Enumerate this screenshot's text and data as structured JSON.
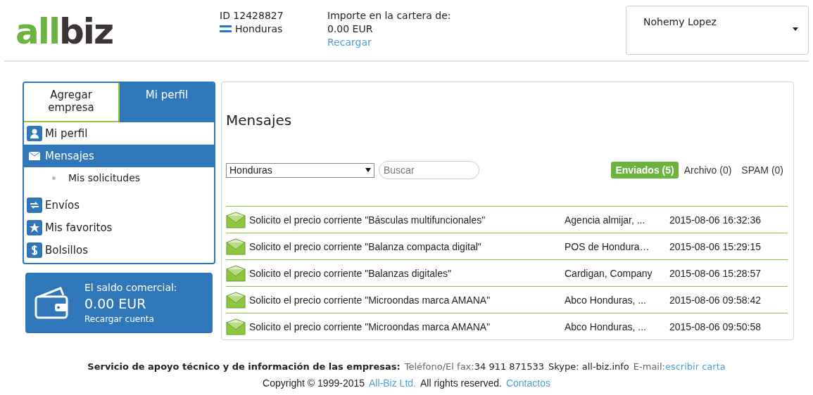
{
  "header": {
    "logo": [
      "all",
      "biz"
    ],
    "account_id": "ID 12428827",
    "country": "Honduras",
    "wallet_label": "Importe en la cartera de:",
    "wallet_amount": "0.00 EUR",
    "recharge_link": "Recargar",
    "user": "Nohemy Lopez"
  },
  "sidebar": {
    "tabs": [
      {
        "label": "Agregar empresa",
        "selected": false
      },
      {
        "label": "Mi perfil",
        "selected": true
      }
    ],
    "items": [
      {
        "label": "Mi perfil",
        "selected": false
      },
      {
        "label": "Mensajes",
        "selected": true,
        "children": [
          {
            "label": "Mis solicitudes"
          }
        ]
      },
      {
        "label": "Envíos",
        "selected": false
      },
      {
        "label": "Mis favoritos",
        "selected": false
      },
      {
        "label": "Bolsillos",
        "selected": false
      }
    ],
    "balance": {
      "label": "El saldo comercial:",
      "amount": "0.00 EUR",
      "link": "Recargar cuenta"
    }
  },
  "messages": {
    "title": "Mensajes",
    "country_select": "Honduras",
    "search": {
      "placeholder": "Buscar"
    },
    "folders": [
      {
        "label": "Enviados (5)",
        "selected": true
      },
      {
        "label": "Archivo (0)",
        "selected": false
      },
      {
        "label": "SPAM (0)",
        "selected": false
      }
    ],
    "rows": [
      {
        "subject": "Solicito el precio corriente \"Básculas multifuncionales\"",
        "company": "Agencia almijar, ...",
        "date": "2015-08-06 16:32:36"
      },
      {
        "subject": "Solicito el precio corriente \"Balanza compacta digital\"",
        "company": "POS de Hondura…",
        "date": "2015-08-06 15:29:15"
      },
      {
        "subject": "Solicito el precio corriente \"Balanzas digitales\"",
        "company": "Cardigan, Company",
        "date": "2015-08-06 15:28:57"
      },
      {
        "subject": "Solicito el precio corriente \"Microondas marca AMANA\"",
        "company": "Abco Honduras, ...",
        "date": "2015-08-06 09:58:42"
      },
      {
        "subject": "Solicito el precio corriente \"Microondas marca AMANA\"",
        "company": "Abco Honduras, ...",
        "date": "2015-08-06 09:50:58"
      }
    ]
  },
  "footer": {
    "support_label": "Servicio de apoyo técnico y de información de las empresas:",
    "phone_label": "Teléfono/El fax:",
    "phone": "34 911 871533",
    "skype": "Skype: all-biz.info",
    "email_label": "E-mail:",
    "email_link": "escribir carta",
    "copyright": "Copyright © 1999-2015",
    "company_link": "All-Biz Ltd.",
    "rights": "All rights reserved.",
    "contacts_link": "Contactos"
  }
}
